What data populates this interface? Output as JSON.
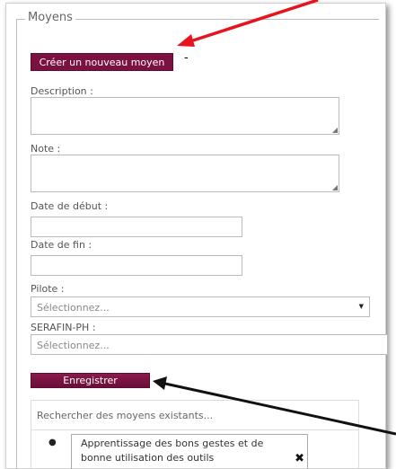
{
  "section": {
    "legend": "Moyens"
  },
  "actions": {
    "create_label": "Créer un nouveau moyen",
    "separator": "-",
    "save_label": "Enregistrer"
  },
  "fields": {
    "description_label": "Description :",
    "note_label": "Note :",
    "start_date_label": "Date de début :",
    "end_date_label": "Date de fin :",
    "pilote_label": "Pilote :",
    "pilote_value": "Sélectionnez...",
    "serafin_label": "SERAFIN-PH :",
    "serafin_value": "Sélectionnez..."
  },
  "search": {
    "placeholder": "Rechercher des moyens existants..."
  },
  "existing": {
    "items": [
      {
        "label": "Apprentissage des bons gestes et de bonne utilisation des outils"
      }
    ]
  },
  "annotations": {
    "arrow_top_color": "#e8141d",
    "arrow_bottom_color": "#111111"
  },
  "colors": {
    "button_bg": "#7b1140"
  },
  "icons": {
    "resize": "resize-grip-icon",
    "dropdown": "caret-down-icon",
    "remove": "close-icon"
  }
}
